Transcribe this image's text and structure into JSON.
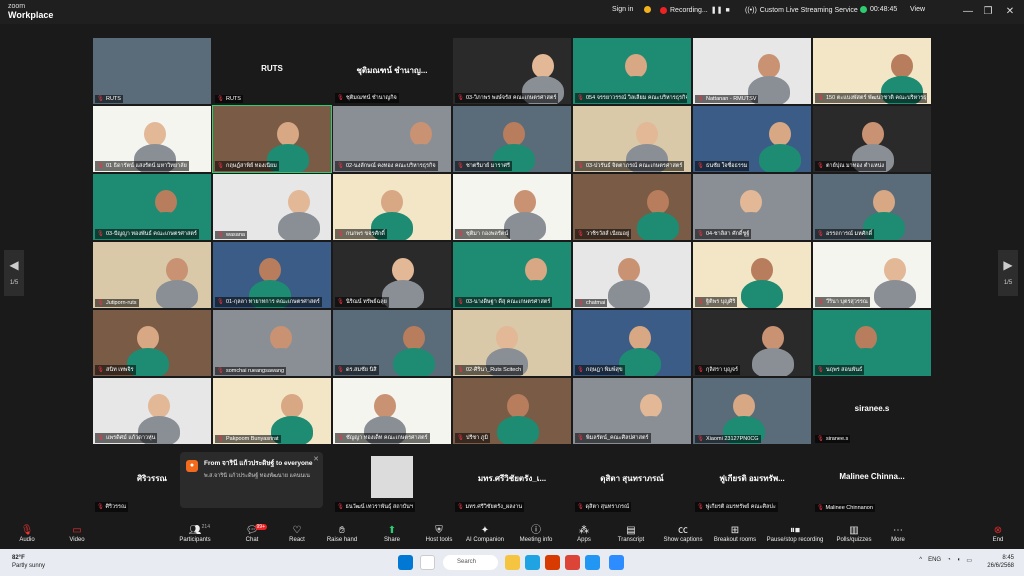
{
  "app": {
    "brand_top": "zoom",
    "brand_bottom": "Workplace"
  },
  "titlebar": {
    "sign_in": "Sign in",
    "recording": "Recording...",
    "stream": "Custom Live Streaming Service",
    "timer": "00:48:45",
    "view": "View"
  },
  "pager": {
    "label": "1/5"
  },
  "tiles": [
    "RUTS",
    "RUTS",
    "ชุติมณฑน์ ชำนาญกิจ",
    "03-วิภาพร พงษ์จรัส คณะเกษตรศาสตร์",
    "054 จรรยาวรรณ์ วิลเลียม คณะบริหารธุรกิจ",
    "Nattanan - RMUTSV",
    "150 ตะแบงพัสตร์ พัฒนาชาติ คณะบริหารธุรกิจ",
    "01 ธิดารัตน์ แสงรัตน์ มหาวิทยาลัย",
    "กฤษฎ์สาพิย์ ทองเนียม",
    "02-นงลักษณ์ คงทอง คณะบริหารธุรกิจ",
    "ชาตรีมาย์ มาราศรี",
    "03-ปวรันธ์ จิตตาภรณ์ คณะเกษตรศาสตร์",
    "ธนชัย ใจซื่อธรรม",
    "ตาย์ปุณ มาทอง ตำแหน่ง",
    "03-ปัญญา ทองพันธ์ คณะเกษตรศาสตร์",
    "wasana",
    "กนกพร ขจรศักดิ์",
    "ชุติมา กองพลรัตน์",
    "วาชิรวัสส์ เนียมอยู่",
    "04-ชาลิสา ศักดิ์ชูฐ์",
    "อรรถการณ์ มหศักดิ์",
    "Jutiporn-ruts",
    "01-กุลลา ทายาทการ คณะเกษตรศาสตร์",
    "นิริณน์ ทรัพย์ฉลุย",
    "03-นางดิษฐา ดีสุ คณะเกษตรศาสตร์",
    "chatmai",
    "ฐิติพร บุญศิริ",
    "วีรินา บุตรสุวรรณ",
    "สนิท เทพจิร",
    "somchai rueangsawang",
    "ดร.สมชัย นิสิ",
    "02-ศิรินา_Ruts Scitech",
    "กฤษฎา พิมพ์สุข",
    "กุลิสรา บุญจร์",
    "นฤพร สอนพันธ์",
    "แพรดิศม์ แก้วดาวหุ่น",
    "Pakpoom Bunyasrirat",
    "ชัญญา ทองเด็ท คณะเกษตรศาสตร์",
    "ปรีชา ภูมิ",
    "พิมลรัตน์_คณะศิลปศาสตร์",
    "Xiaomi 23127PN0CG",
    "siranee.s"
  ],
  "siranee_center": "siranee.s",
  "rts_center_1": "RUTS",
  "rts_center_2": "ชุติมณฑน์ ชำนาญ...",
  "bottom": [
    {
      "center": "ศิริวรรณ",
      "label": "ศิริวรรณ"
    },
    {
      "center": "",
      "label": "ธนวัฒน์ เทวราพันธุ์ สถาบันฯ"
    },
    {
      "center": "มทร.ศรีวิชัยตรัง_เ...",
      "label": "มทร.ศรีวิชัยตรัง_ผลงาน"
    },
    {
      "center": "ดุสิตา สุนทราภรณ์",
      "label": "ดุสิตา สุนทราภรณ์"
    },
    {
      "center": "ฟูเกียรติ อมรทรัพ...",
      "label": "ฟูเกียรติ อมรทรัพย์ คณะศิลปะ"
    },
    {
      "center": "Malinee Chinna...",
      "label": "Malinee Chinnanon"
    }
  ],
  "chat_popup": {
    "from": "From จารินี แก้วประดิษฐ์ to everyone",
    "message": "พ.ส.จารินี แก้วประดิษฐ์ ทองพัฒนาย แคนนเน"
  },
  "toolbar": {
    "audio": "Audio",
    "video": "Video",
    "participants": "Participants",
    "participant_count": "214",
    "chat": "Chat",
    "chat_badge": "99+",
    "react": "React",
    "raise": "Raise hand",
    "share": "Share",
    "host": "Host tools",
    "ai": "AI Companion",
    "meeting_info": "Meeting info",
    "apps": "Apps",
    "transcript": "Transcript",
    "captions": "Show captions",
    "breakout": "Breakout rooms",
    "pause": "Pause/stop recording",
    "polls": "Polls/quizzes",
    "more": "More",
    "end": "End"
  },
  "taskbar": {
    "temp": "82°F",
    "weather": "Partly sunny",
    "search": "Search",
    "lang": "ENG",
    "time": "8:45",
    "date": "26/6/2568"
  },
  "colors": {
    "accent": "#2ecc71",
    "end": "#e02828",
    "chat": "#f26b1d"
  }
}
